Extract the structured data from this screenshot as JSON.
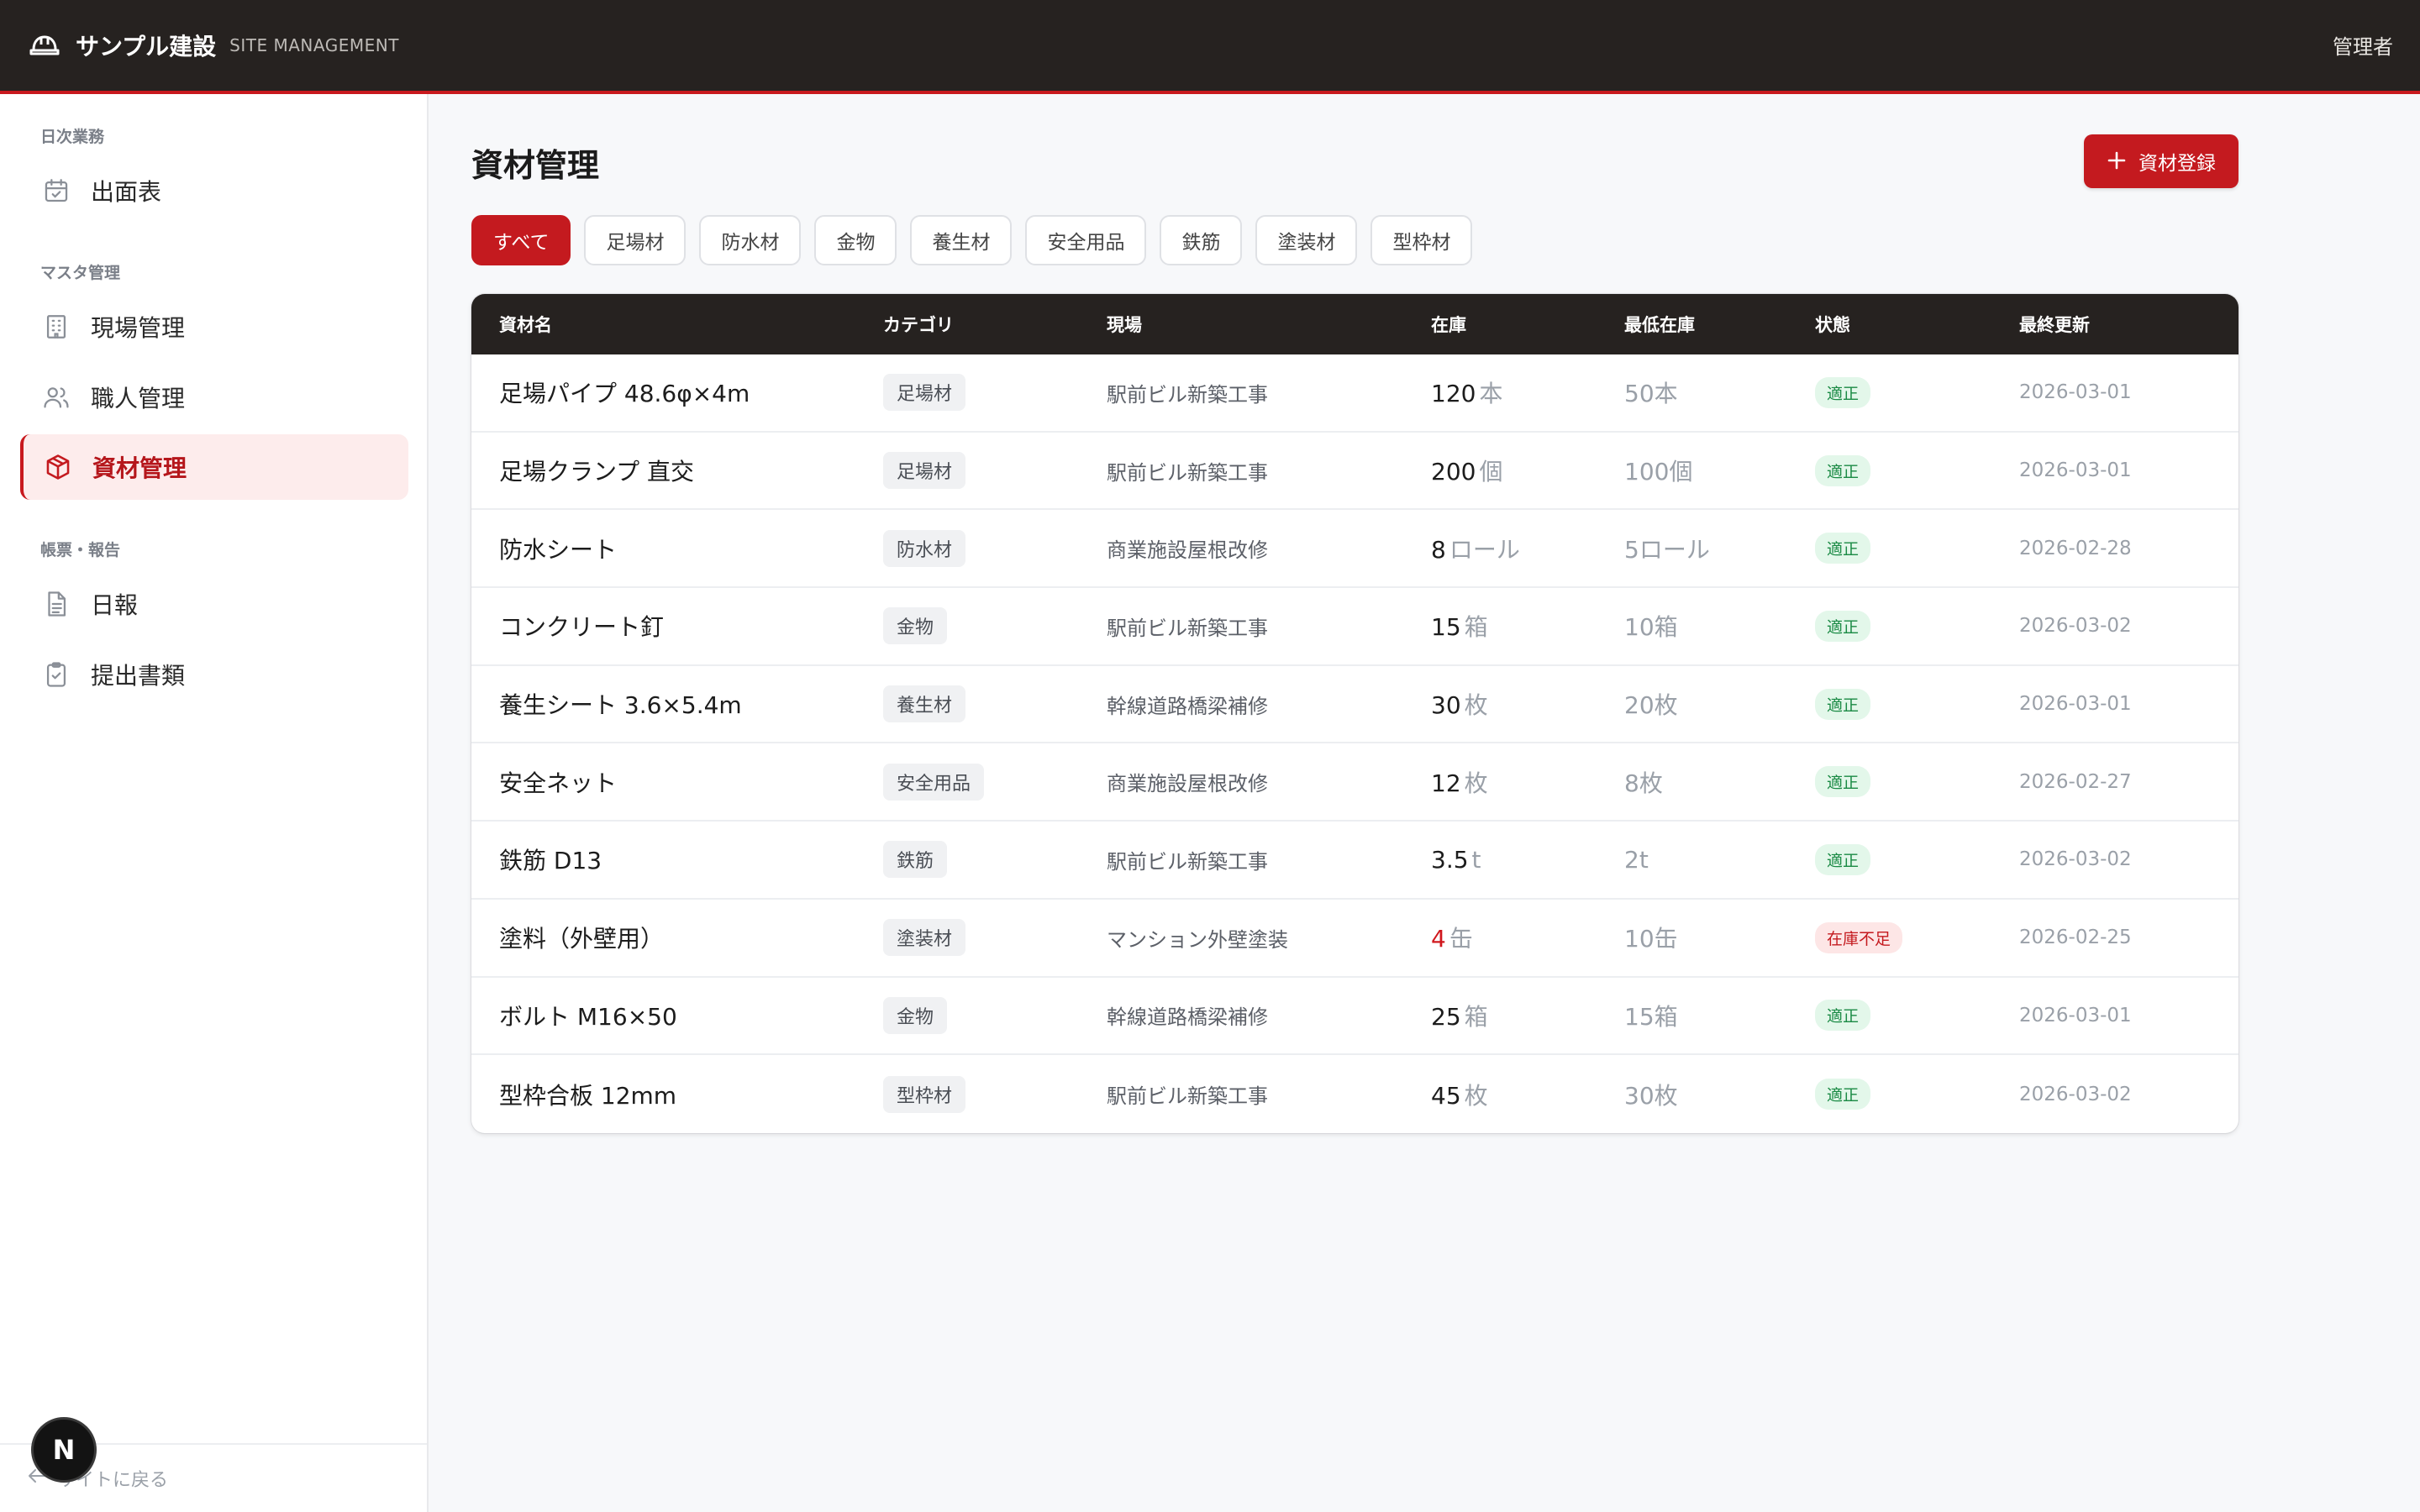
{
  "header": {
    "brand": "サンプル建設",
    "brand_sub": "SITE MANAGEMENT",
    "user": "管理者",
    "accent": "#c41a1f"
  },
  "sidebar": {
    "sections": [
      {
        "label": "日次業務"
      },
      {
        "label": "マスタ管理"
      },
      {
        "label": "帳票・報告"
      }
    ],
    "items": [
      {
        "label": "出面表",
        "icon": "calendar-check-icon"
      },
      {
        "label": "現場管理",
        "icon": "building-icon"
      },
      {
        "label": "職人管理",
        "icon": "users-icon"
      },
      {
        "label": "資材管理",
        "icon": "box-icon",
        "active": true
      },
      {
        "label": "日報",
        "icon": "document-icon"
      },
      {
        "label": "提出書類",
        "icon": "clipboard-check-icon"
      }
    ],
    "back_label": "サイトに戻る",
    "badge_letter": "N"
  },
  "main": {
    "title": "資材管理",
    "add_button": "資材登録",
    "filters": [
      "すべて",
      "足場材",
      "防水材",
      "金物",
      "養生材",
      "安全用品",
      "鉄筋",
      "塗装材",
      "型枠材"
    ],
    "active_filter": "すべて",
    "columns": [
      "資材名",
      "カテゴリ",
      "現場",
      "在庫",
      "最低在庫",
      "状態",
      "最終更新"
    ],
    "rows": [
      {
        "name": "足場パイプ 48.6φ×4m",
        "cat": "足場材",
        "site": "駅前ビル新築工事",
        "stock": "120",
        "unit": "本",
        "min": "50本",
        "status": "適正",
        "date": "2026-03-01"
      },
      {
        "name": "足場クランプ 直交",
        "cat": "足場材",
        "site": "駅前ビル新築工事",
        "stock": "200",
        "unit": "個",
        "min": "100個",
        "status": "適正",
        "date": "2026-03-01"
      },
      {
        "name": "防水シート",
        "cat": "防水材",
        "site": "商業施設屋根改修",
        "stock": "8",
        "unit": "ロール",
        "min": "5ロール",
        "status": "適正",
        "date": "2026-02-28"
      },
      {
        "name": "コンクリート釘",
        "cat": "金物",
        "site": "駅前ビル新築工事",
        "stock": "15",
        "unit": "箱",
        "min": "10箱",
        "status": "適正",
        "date": "2026-03-02"
      },
      {
        "name": "養生シート 3.6×5.4m",
        "cat": "養生材",
        "site": "幹線道路橋梁補修",
        "stock": "30",
        "unit": "枚",
        "min": "20枚",
        "status": "適正",
        "date": "2026-03-01"
      },
      {
        "name": "安全ネット",
        "cat": "安全用品",
        "site": "商業施設屋根改修",
        "stock": "12",
        "unit": "枚",
        "min": "8枚",
        "status": "適正",
        "date": "2026-02-27"
      },
      {
        "name": "鉄筋 D13",
        "cat": "鉄筋",
        "site": "駅前ビル新築工事",
        "stock": "3.5",
        "unit": "t",
        "min": "2t",
        "status": "適正",
        "date": "2026-03-02"
      },
      {
        "name": "塗料（外壁用）",
        "cat": "塗装材",
        "site": "マンション外壁塗装",
        "stock": "4",
        "unit": "缶",
        "min": "10缶",
        "status": "在庫不足",
        "low": true,
        "date": "2026-02-25"
      },
      {
        "name": "ボルト M16×50",
        "cat": "金物",
        "site": "幹線道路橋梁補修",
        "stock": "25",
        "unit": "箱",
        "min": "15箱",
        "status": "適正",
        "date": "2026-03-01"
      },
      {
        "name": "型枠合板 12mm",
        "cat": "型枠材",
        "site": "駅前ビル新築工事",
        "stock": "45",
        "unit": "枚",
        "min": "30枚",
        "status": "適正",
        "date": "2026-03-02"
      }
    ]
  }
}
